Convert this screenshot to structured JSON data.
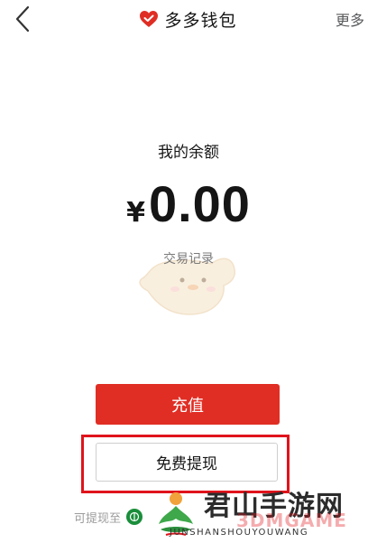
{
  "header": {
    "title": "多多钱包",
    "more_label": "更多",
    "brand_color": "#e02e24"
  },
  "balance": {
    "label": "我的余额",
    "currency": "¥",
    "amount": "0.00"
  },
  "transactions": {
    "label": "交易记录"
  },
  "actions": {
    "recharge_label": "充值",
    "withdraw_label": "免费提现",
    "highlight_color": "#e0131b"
  },
  "footer": {
    "withdraw_to_label": "可提现至"
  },
  "watermark": {
    "text": "君山手游网",
    "subtext": "JUNSHANSHOUYOUWANG",
    "overlay": "3DMGAME"
  }
}
